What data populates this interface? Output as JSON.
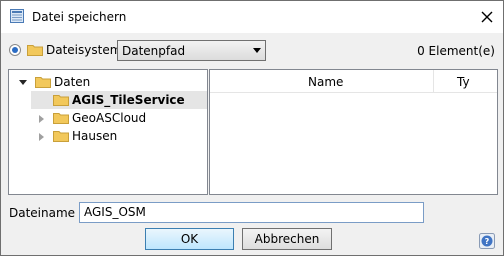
{
  "window": {
    "title": "Datei speichern"
  },
  "source": {
    "radio_label": "Dateisystem",
    "select_value": "Datenpfad",
    "count": "0 Element(e)"
  },
  "tree": {
    "root": "Daten",
    "children": [
      "AGIS_TileService",
      "GeoASCloud",
      "Hausen"
    ],
    "selected": "AGIS_TileService"
  },
  "list": {
    "columns": [
      "Name",
      "Ty"
    ]
  },
  "filename": {
    "label": "Dateiname",
    "value": "AGIS_OSM"
  },
  "buttons": {
    "ok": "OK",
    "cancel": "Abbrechen"
  },
  "colors": {
    "folder": "#f2c85b",
    "selection": "#e5e5e5",
    "radio_dot": "#2b6cc4"
  },
  "icons": {
    "title": "save-dialog-icon",
    "close": "close-icon",
    "help": "help-icon"
  }
}
